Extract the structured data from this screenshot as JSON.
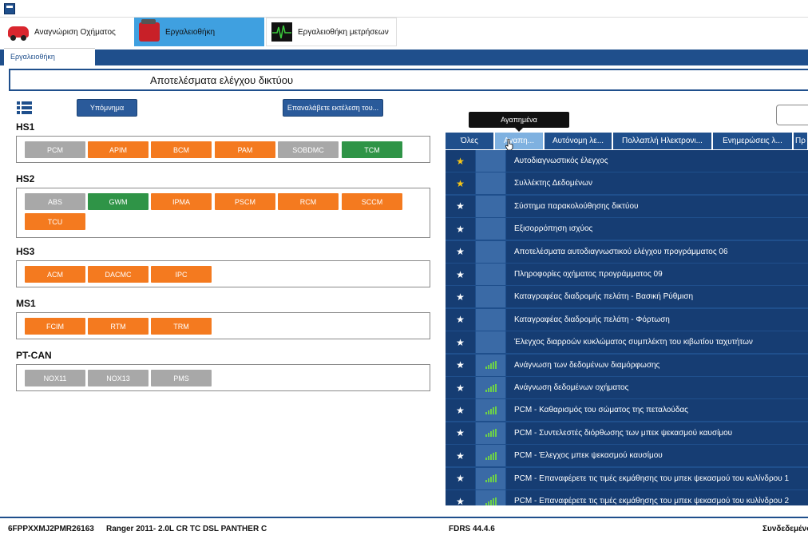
{
  "main_tabs": [
    {
      "label": "Αναγνώριση Οχήματος",
      "icon": "car-icon"
    },
    {
      "label": "Εργαλειοθήκη",
      "icon": "toolbox-icon"
    },
    {
      "label": "Εργαλειοθήκη μετρήσεων",
      "icon": "oscilloscope-icon"
    }
  ],
  "sub_tab": "Εργαλειοθήκη",
  "page_title": "Αποτελέσματα ελέγχου δικτύου",
  "buttons": {
    "legend": "Υπόμνημα",
    "rerun": "Επαναλάβετε εκτέλεση του..."
  },
  "groups": [
    {
      "name": "HS1",
      "modules": [
        {
          "label": "PCM",
          "status": "grey"
        },
        {
          "label": "APIM",
          "status": "orange"
        },
        {
          "label": "BCM",
          "status": "orange"
        },
        {
          "label": "PAM",
          "status": "orange"
        },
        {
          "label": "SOBDMC",
          "status": "grey"
        },
        {
          "label": "TCM",
          "status": "green"
        }
      ]
    },
    {
      "name": "HS2",
      "modules": [
        {
          "label": "ABS",
          "status": "grey"
        },
        {
          "label": "GWM",
          "status": "green"
        },
        {
          "label": "IPMA",
          "status": "orange"
        },
        {
          "label": "PSCM",
          "status": "orange"
        },
        {
          "label": "RCM",
          "status": "orange"
        },
        {
          "label": "SCCM",
          "status": "orange"
        },
        {
          "label": "TCU",
          "status": "orange"
        }
      ]
    },
    {
      "name": "HS3",
      "modules": [
        {
          "label": "ACM",
          "status": "orange"
        },
        {
          "label": "DACMC",
          "status": "orange"
        },
        {
          "label": "IPC",
          "status": "orange"
        }
      ]
    },
    {
      "name": "MS1",
      "modules": [
        {
          "label": "FCIM",
          "status": "orange"
        },
        {
          "label": "RTM",
          "status": "orange"
        },
        {
          "label": "TRM",
          "status": "orange"
        }
      ]
    },
    {
      "name": "PT-CAN",
      "modules": [
        {
          "label": "NOX11",
          "status": "grey"
        },
        {
          "label": "NOX13",
          "status": "grey"
        },
        {
          "label": "PMS",
          "status": "grey"
        }
      ]
    }
  ],
  "tooltip": "Αγαπημένα",
  "filter_tabs": [
    "Όλες",
    "Αγαπη...",
    "Αυτόνομη λε...",
    "Πολλαπλή Ηλεκτρονι...",
    "Ενημερώσεις λ...",
    "Πρ"
  ],
  "tools": [
    {
      "name": "Αυτοδιαγνωστικός έλεγχος",
      "favorite": true,
      "signal": false
    },
    {
      "name": "Συλλέκτης Δεδομένων",
      "favorite": true,
      "signal": false
    },
    {
      "name": "Σύστημα παρακολούθησης δικτύου",
      "favorite": false,
      "signal": false
    },
    {
      "name": "Εξισορρόπηση ισχύος",
      "favorite": false,
      "signal": false
    },
    {
      "name": "Αποτελέσματα αυτοδιαγνωστικού ελέγχου προγράμματος 06",
      "favorite": false,
      "signal": false
    },
    {
      "name": "Πληροφορίες οχήματος προγράμματος 09",
      "favorite": false,
      "signal": false
    },
    {
      "name": "Καταγραφέας διαδρομής πελάτη - Βασική Ρύθμιση",
      "favorite": false,
      "signal": false
    },
    {
      "name": "Καταγραφέας διαδρομής πελάτη - Φόρτωση",
      "favorite": false,
      "signal": false
    },
    {
      "name": "Έλεγχος διαρροών κυκλώματος συμπλέκτη του κιβωτίου ταχυτήτων",
      "favorite": false,
      "signal": false
    },
    {
      "name": "Ανάγνωση των δεδομένων διαμόρφωσης",
      "favorite": false,
      "signal": true
    },
    {
      "name": "Ανάγνωση δεδομένων οχήματος",
      "favorite": false,
      "signal": true
    },
    {
      "name": "PCM - Καθαρισμός του σώματος της πεταλούδας",
      "favorite": false,
      "signal": true
    },
    {
      "name": "PCM - Συντελεστές διόρθωσης των μπεκ ψεκασμού καυσίμου",
      "favorite": false,
      "signal": true
    },
    {
      "name": "PCM - Έλεγχος μπεκ ψεκασμού καυσίμου",
      "favorite": false,
      "signal": true
    },
    {
      "name": "PCM - Επαναφέρετε τις τιμές εκμάθησης του μπεκ ψεκασμού του κυλίνδρου 1",
      "favorite": false,
      "signal": true
    },
    {
      "name": "PCM - Επαναφέρετε τις τιμές εκμάθησης του μπεκ ψεκασμού του κυλίνδρου 2",
      "favorite": false,
      "signal": true
    }
  ],
  "status": {
    "vin": "6FPPXXMJ2PMR26163",
    "vehicle": "Ranger 2011- 2.0L CR TC DSL PANTHER C",
    "version": "FDRS 44.4.6",
    "connection": "Συνδεδεμένο"
  },
  "colors": {
    "brand_blue": "#1f4f8c",
    "ok": "#2f9447",
    "fault": "#f47a1f",
    "no_response": "#a8a8a8",
    "favorite": "#f5c518"
  }
}
